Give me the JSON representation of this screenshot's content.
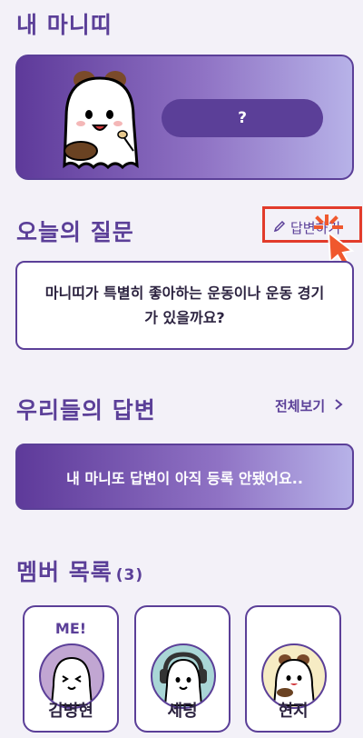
{
  "sections": {
    "my_manito": "내 마니띠",
    "todays_question": "오늘의 질문",
    "our_answers": "우리들의 답변",
    "member_list": "멤버 목록"
  },
  "manito_card": {
    "reveal_label": "?"
  },
  "answer_link": {
    "label": "답변하기"
  },
  "question": {
    "text": "마니띠가 특별히 좋아하는 운동이나 운동 경기가 있을까요?"
  },
  "see_all": {
    "label": "전체보기"
  },
  "answer_banner": {
    "text": "내 마니또 답변이 아직 등록 안됐어요.."
  },
  "members": {
    "count": "(3)",
    "items": [
      {
        "name": "김병현",
        "tag": "ME!",
        "avatar_bg": "#c1a6d2"
      },
      {
        "name": "세덩",
        "tag": "",
        "avatar_bg": "#a9d6d6"
      },
      {
        "name": "현지",
        "tag": "",
        "avatar_bg": "#f6ecc4"
      }
    ]
  },
  "colors": {
    "primary": "#5b3f98",
    "highlight": "#e23b2b",
    "cursor": "#f0582e"
  }
}
